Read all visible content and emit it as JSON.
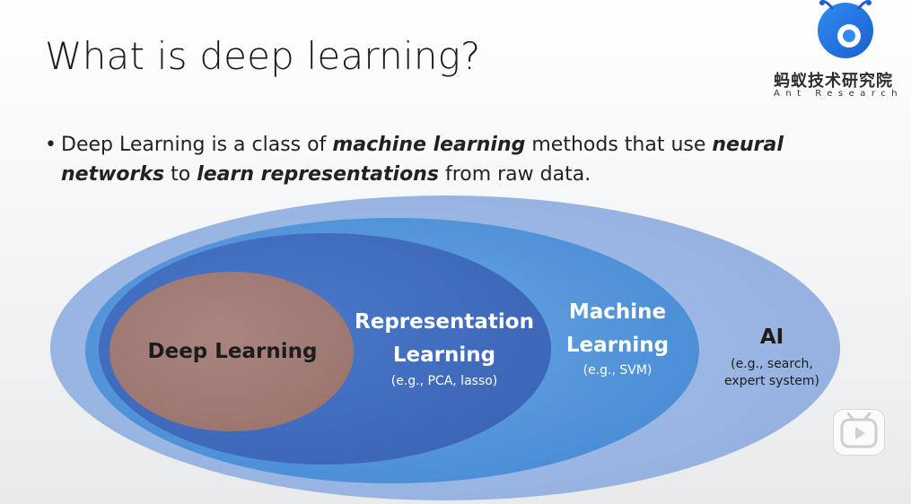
{
  "slide": {
    "title": "What is deep learning?"
  },
  "logo": {
    "cn": "蚂蚁技术研究院",
    "en": "Ant Research",
    "icon": "ant-research-logo-icon"
  },
  "bullet": {
    "segments": [
      {
        "text": "Deep Learning is a class of ",
        "em": false
      },
      {
        "text": "machine learning",
        "em": true
      },
      {
        "text": " methods that use ",
        "em": false
      },
      {
        "text": "neural networks",
        "em": true
      },
      {
        "text": " to ",
        "em": false
      },
      {
        "text": "learn representations",
        "em": true
      },
      {
        "text": " from raw data.",
        "em": false
      }
    ]
  },
  "diagram": {
    "ai": {
      "title": "AI",
      "sub1": "(e.g., search,",
      "sub2": "expert system)",
      "color": "#9db7e2"
    },
    "ml": {
      "title1": "Machine",
      "title2": "Learning",
      "sub": "(e.g., SVM)",
      "color": "#5b9bd9"
    },
    "rl": {
      "title1": "Representation",
      "title2": "Learning",
      "sub": "(e.g., PCA, lasso)",
      "color": "#4472c4"
    },
    "dl": {
      "title": "Deep Learning",
      "color": "#a47d78"
    }
  },
  "overlay": {
    "play_icon": "play-icon"
  }
}
